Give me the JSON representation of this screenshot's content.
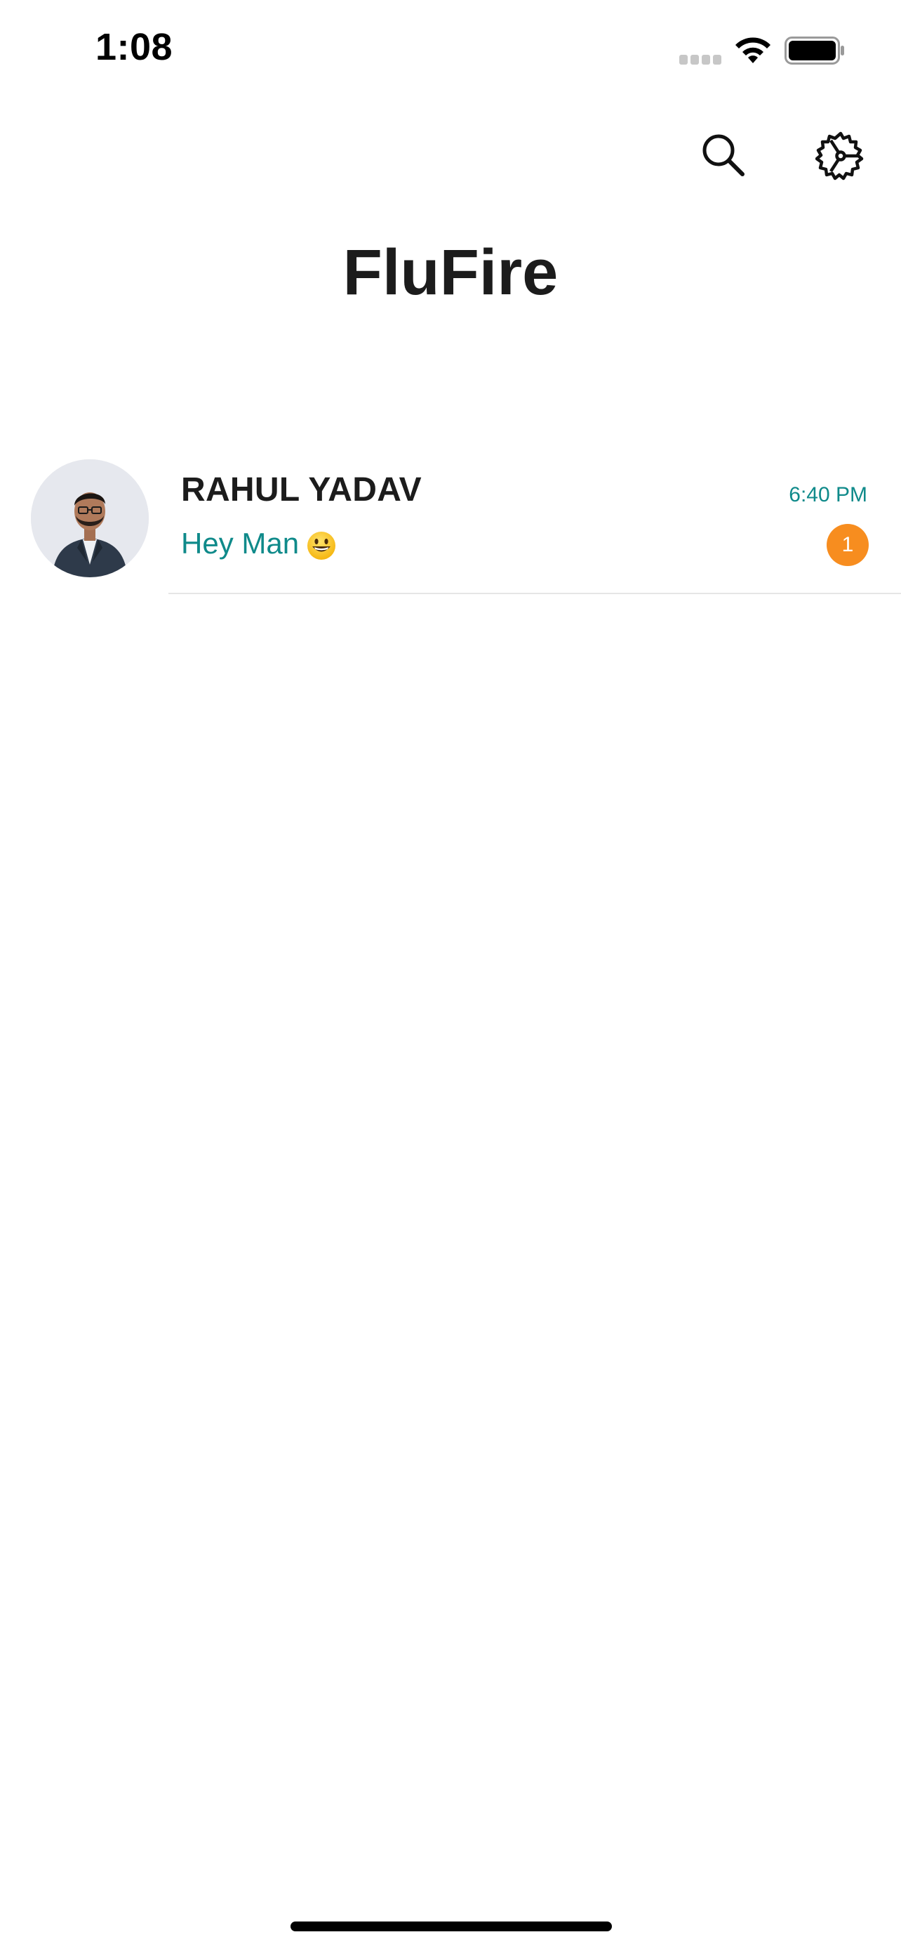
{
  "status_bar": {
    "time": "1:08",
    "icons": [
      "signal-dots-icon",
      "wifi-icon",
      "battery-icon"
    ]
  },
  "header": {
    "actions": [
      "search-icon",
      "settings-gear-icon"
    ]
  },
  "app": {
    "title": "FluFire"
  },
  "chats": [
    {
      "name": "RAHUL YADAV",
      "message": "Hey Man",
      "emoji": "grinning-face-icon",
      "time": "6:40 PM",
      "unread": "1",
      "avatar": "profile-photo"
    }
  ],
  "colors": {
    "accent_teal": "#0f8a8a",
    "badge_orange": "#f78d1f",
    "text_dark": "#1c1c1c",
    "divider": "#e6e6e6"
  }
}
